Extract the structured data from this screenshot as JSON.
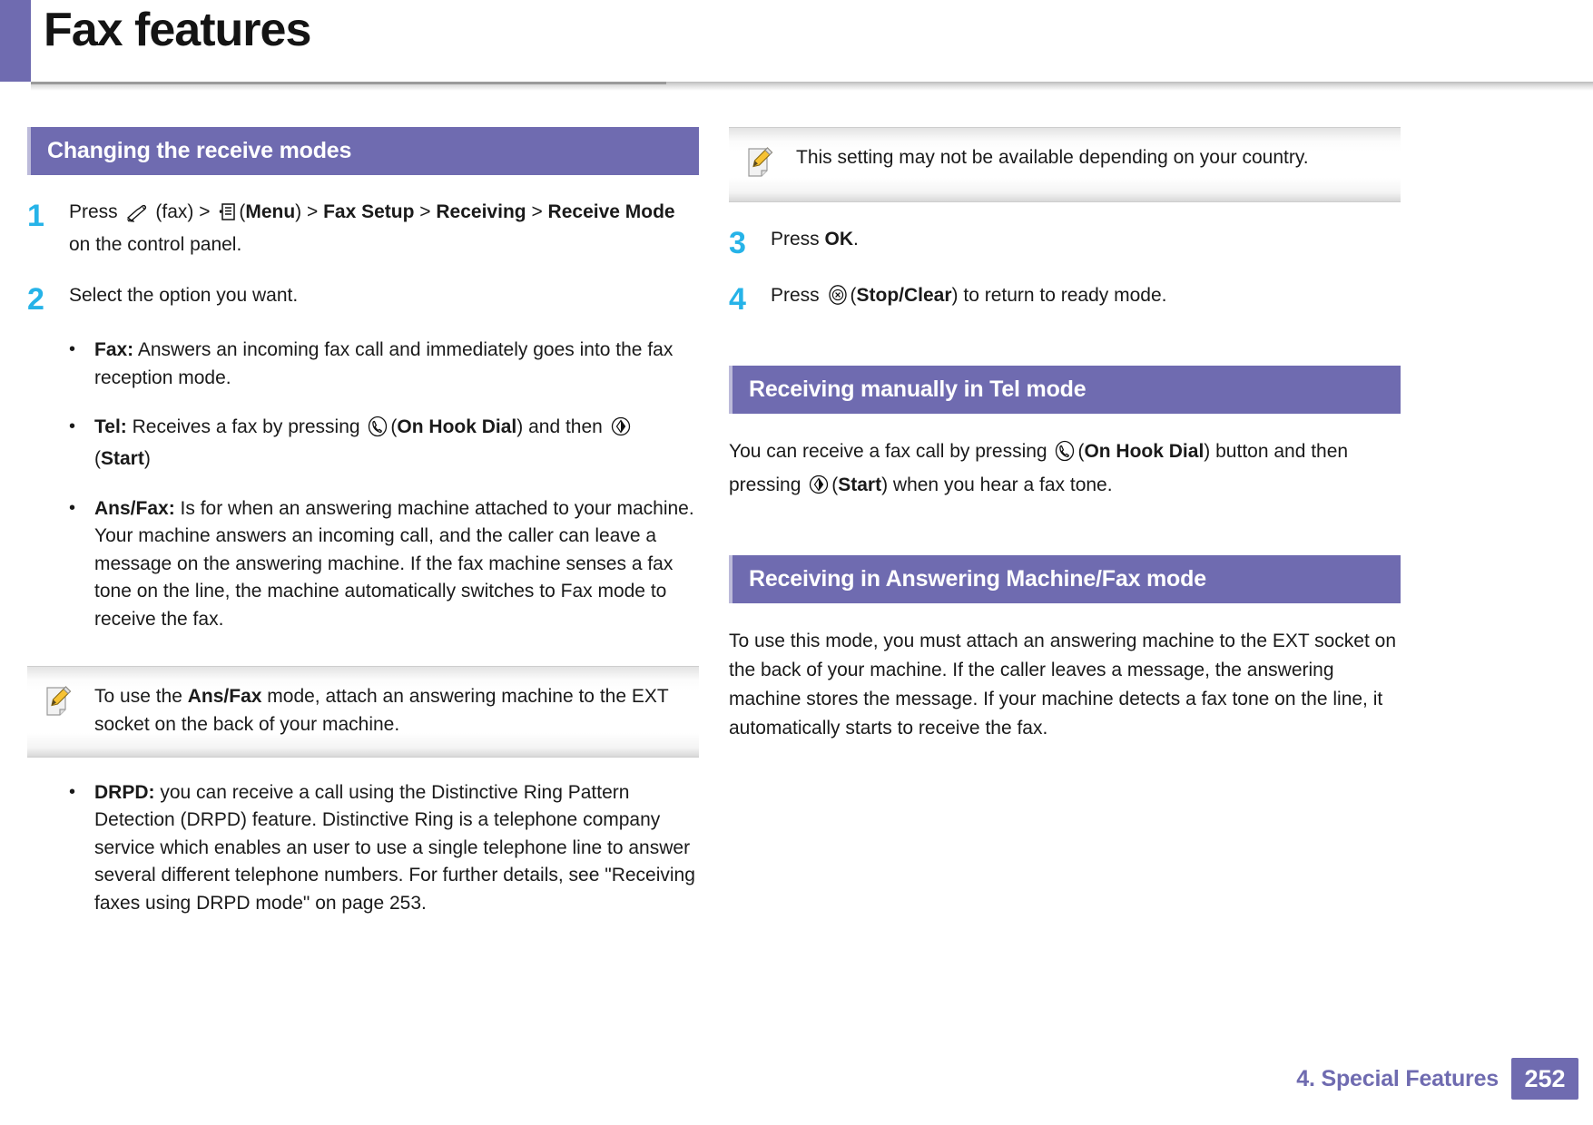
{
  "document": {
    "title": "Fax features",
    "accent_color": "#6f6bb0",
    "step_number_color": "#26b3e8"
  },
  "footer": {
    "chapter": "4.  Special Features",
    "page_number": "252"
  },
  "left_column": {
    "section_heading": "Changing the receive modes",
    "step1": {
      "number": "1",
      "text_a": "Press",
      "fax_label": "(fax) >",
      "menu_open": "(",
      "menu_bold": "Menu",
      "menu_close": ") > ",
      "path_1": "Fax Setup",
      "sep_1": " > ",
      "path_2": "Receiving",
      "sep_2": " > ",
      "path_3": "Receive Mode",
      "tail": " on the control panel."
    },
    "step2": {
      "number": "2",
      "text": "Select the option you want."
    },
    "bullets": [
      {
        "dot": "•",
        "term": "Fax:",
        "text": " Answers an incoming fax call and immediately goes into the fax reception mode."
      },
      {
        "dot": "•",
        "term": "Tel:",
        "text_a": " Receives a fax by pressing ",
        "btn_1_open": "(",
        "btn_1": "On Hook Dial",
        "btn_1_close": ") and then ",
        "btn_2_open": "(",
        "btn_2": "Start",
        "btn_2_close": ")"
      },
      {
        "dot": "•",
        "term": "Ans/Fax:",
        "text": " Is for when an answering machine attached to your machine. Your machine answers an incoming call, and the caller can leave a message on the answering machine. If the fax machine senses a fax tone on the line, the machine automatically switches to Fax mode to receive the fax."
      },
      {
        "dot": "•",
        "term": "DRPD:",
        "text": " you can receive a call using the Distinctive Ring Pattern Detection (DRPD) feature. Distinctive Ring is a telephone company service which enables an user to use a single telephone line to answer several different telephone numbers. For further details, see \"Receiving faxes using DRPD mode\" on page 253."
      }
    ],
    "note": {
      "text_a": "To use the ",
      "bold": "Ans/Fax",
      "text_b": " mode, attach an answering machine to the EXT socket on the back of your machine."
    }
  },
  "right_column": {
    "note": {
      "text": "This setting may not be available depending on your country."
    },
    "step3": {
      "number": "3",
      "text_a": "Press ",
      "bold": "OK",
      "text_b": "."
    },
    "step4": {
      "number": "4",
      "text_a": "Press ",
      "btn_open": "(",
      "btn": "Stop/Clear",
      "btn_close": ") to return to ready mode."
    },
    "section_tel": {
      "heading": "Receiving manually in Tel mode",
      "paragraph_a": "You can receive a fax call by pressing ",
      "btn_1_open": "(",
      "btn_1": "On Hook Dial",
      "btn_1_close": ") button and then pressing ",
      "btn_2_open": "(",
      "btn_2": "Start",
      "btn_2_close": ") when you hear a fax tone."
    },
    "section_ans": {
      "heading": "Receiving in Answering Machine/Fax mode",
      "paragraph": "To use this mode, you must attach an answering machine to the EXT socket on the back of your machine. If the caller leaves a message, the answering machine stores the message. If your machine detects a fax tone on the line, it automatically starts to receive the fax."
    }
  },
  "icons": {
    "fax": "fax-handset-icon",
    "menu": "menu-document-icon",
    "on_hook_dial": "on-hook-dial-icon",
    "start": "start-icon",
    "stop_clear": "stop-clear-icon",
    "note": "note-pencil-icon"
  }
}
